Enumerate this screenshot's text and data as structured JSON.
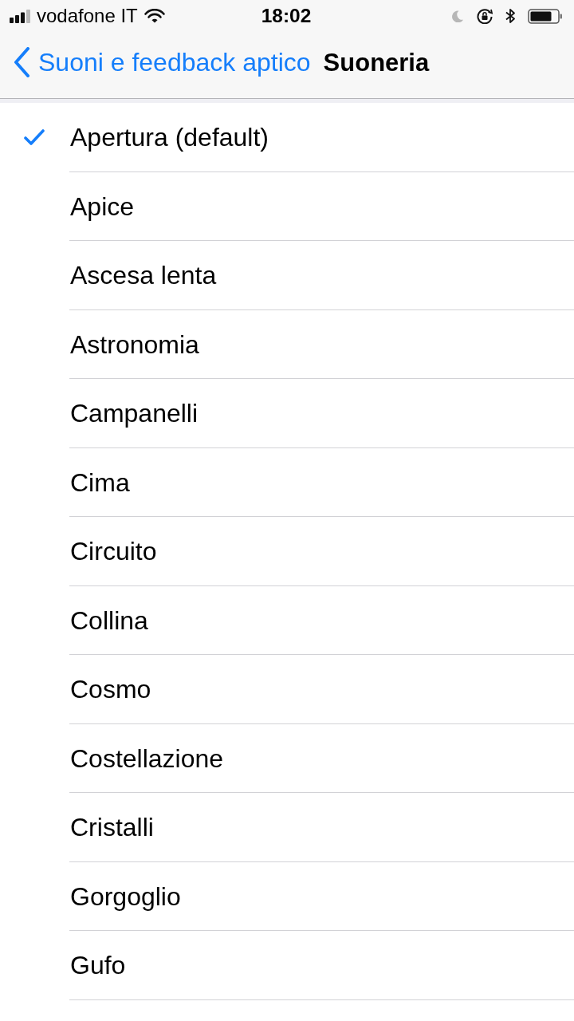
{
  "status_bar": {
    "carrier": "vodafone IT",
    "time": "18:02"
  },
  "nav_bar": {
    "back_label": "Suoni e feedback aptico",
    "title": "Suoneria"
  },
  "ringtones": [
    {
      "label": "Apertura (default)",
      "selected": true
    },
    {
      "label": "Apice",
      "selected": false
    },
    {
      "label": "Ascesa lenta",
      "selected": false
    },
    {
      "label": "Astronomia",
      "selected": false
    },
    {
      "label": "Campanelli",
      "selected": false
    },
    {
      "label": "Cima",
      "selected": false
    },
    {
      "label": "Circuito",
      "selected": false
    },
    {
      "label": "Collina",
      "selected": false
    },
    {
      "label": "Cosmo",
      "selected": false
    },
    {
      "label": "Costellazione",
      "selected": false
    },
    {
      "label": "Cristalli",
      "selected": false
    },
    {
      "label": "Gorgoglio",
      "selected": false
    },
    {
      "label": "Gufo",
      "selected": false
    }
  ]
}
